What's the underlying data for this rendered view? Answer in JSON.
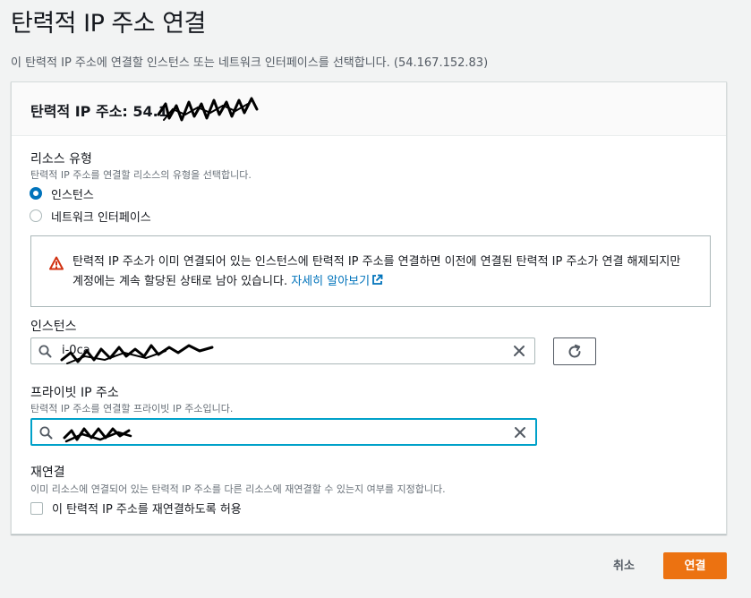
{
  "page": {
    "title": "탄력적 IP 주소 연결",
    "description": "이 탄력적 IP 주소에 연결할 인스턴스 또는 네트워크 인터페이스를 선택합니다. (54.167.152.83)"
  },
  "panel": {
    "title": "탄력적 IP 주소: 54.1"
  },
  "resource_type": {
    "label": "리소스 유형",
    "description": "탄력적 IP 주소를 연결할 리소스의 유형을 선택합니다.",
    "options": [
      {
        "label": "인스턴스",
        "selected": true
      },
      {
        "label": "네트워크 인터페이스",
        "selected": false
      }
    ]
  },
  "alert": {
    "icon": "warning-icon",
    "text": "탄력적 IP 주소가 이미 연결되어 있는 인스턴스에 탄력적 IP 주소를 연결하면 이전에 연결된 탄력적 IP 주소가 연결 해제되지만 계정에는 계속 할당된 상태로 남아 있습니다.",
    "link_text": "자세히 알아보기",
    "color": "#d13212"
  },
  "instance": {
    "label": "인스턴스",
    "value": "i-0ca"
  },
  "private_ip": {
    "label": "프라이빗 IP 주소",
    "description": "탄력적 IP 주소를 연결할 프라이빗 IP 주소입니다."
  },
  "reassociation": {
    "label": "재연결",
    "description": "이미 리소스에 연결되어 있는 탄력적 IP 주소를 다른 리소스에 재연결할 수 있는지 여부를 지정합니다.",
    "checkbox_label": "이 탄력적 IP 주소를 재연결하도록 허용",
    "checked": false
  },
  "footer": {
    "cancel_label": "취소",
    "connect_label": "연결"
  },
  "colors": {
    "primary": "#ec7211",
    "accent": "#0073bb",
    "focus": "#00a1c9"
  }
}
